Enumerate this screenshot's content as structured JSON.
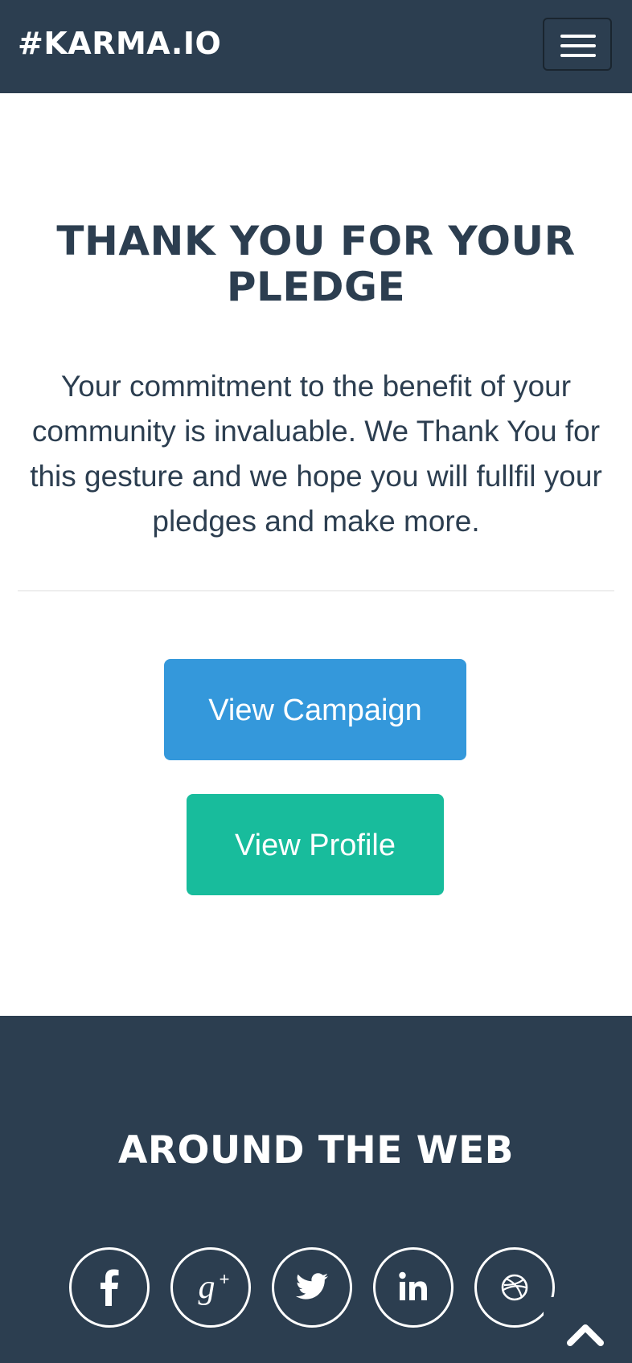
{
  "navbar": {
    "brand": "#KARMA.IO",
    "menu_toggle_icon": "hamburger-menu-icon"
  },
  "main": {
    "title": "THANK YOU FOR YOUR PLEDGE",
    "message": "Your commitment to the benefit of your community is invaluable. We Thank You for this gesture and we hope you will fullfil your pledges and make more.",
    "buttons": {
      "view_campaign": "View Campaign",
      "view_profile": "View Profile"
    }
  },
  "footer": {
    "title": "AROUND THE WEB",
    "social_icons": [
      "facebook-icon",
      "google-plus-icon",
      "twitter-icon",
      "linkedin-icon",
      "dribbble-icon"
    ]
  },
  "scroll_top_icon": "chevron-up-icon",
  "colors": {
    "navy": "#2c3e50",
    "campaign_blue": "#3498db",
    "profile_green": "#18bc9c",
    "white": "#ffffff"
  }
}
